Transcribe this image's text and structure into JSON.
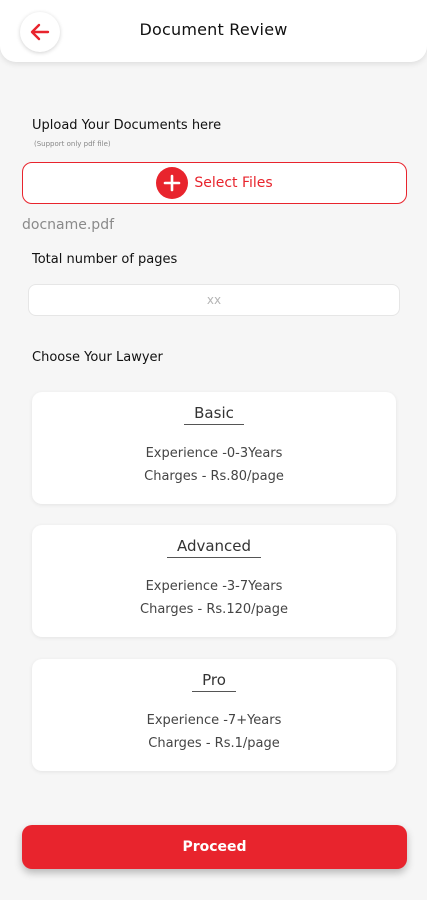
{
  "header": {
    "title": "Document Review",
    "back_icon": "arrow-left-icon",
    "accent_color": "#e8242d"
  },
  "upload": {
    "label": "Upload Your Documents here",
    "note": "(Support only pdf file)",
    "button_label": "Select Files",
    "button_icon": "plus-circle-icon",
    "file_name": "docname.pdf"
  },
  "pages": {
    "label": "Total number of pages",
    "placeholder": "xx"
  },
  "lawyers": {
    "label": "Choose Your Lawyer",
    "cards": [
      {
        "title": "Basic",
        "experience": "Experience -0-3Years",
        "charges": "Charges - Rs.80/page"
      },
      {
        "title": "Advanced",
        "experience": "Experience -3-7Years",
        "charges": "Charges - Rs.120/page"
      },
      {
        "title": "Pro",
        "experience": "Experience -7+Years",
        "charges": "Charges - Rs.1/page"
      }
    ]
  },
  "footer": {
    "proceed_label": "Proceed"
  }
}
